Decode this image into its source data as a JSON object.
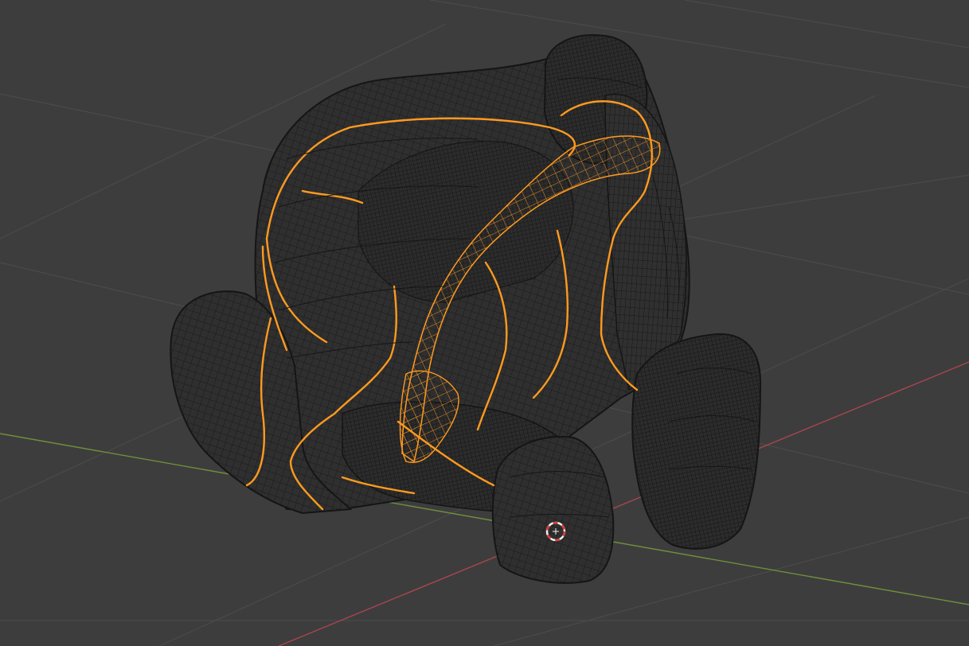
{
  "viewport": {
    "mode": "wireframe",
    "colors": {
      "background": "#3d3d3d",
      "grid_line": "#4a4a4a",
      "x_axis": "#a8454f",
      "y_axis": "#6e8f3c",
      "mesh_wire": "#1a1a1a",
      "mesh_fill": "#2f2f2f",
      "selection": "#ff9a1f",
      "cursor_red": "#e03a3a",
      "cursor_white": "#f0f0f0"
    },
    "icons": {
      "cursor": "3d-cursor-icon"
    }
  }
}
